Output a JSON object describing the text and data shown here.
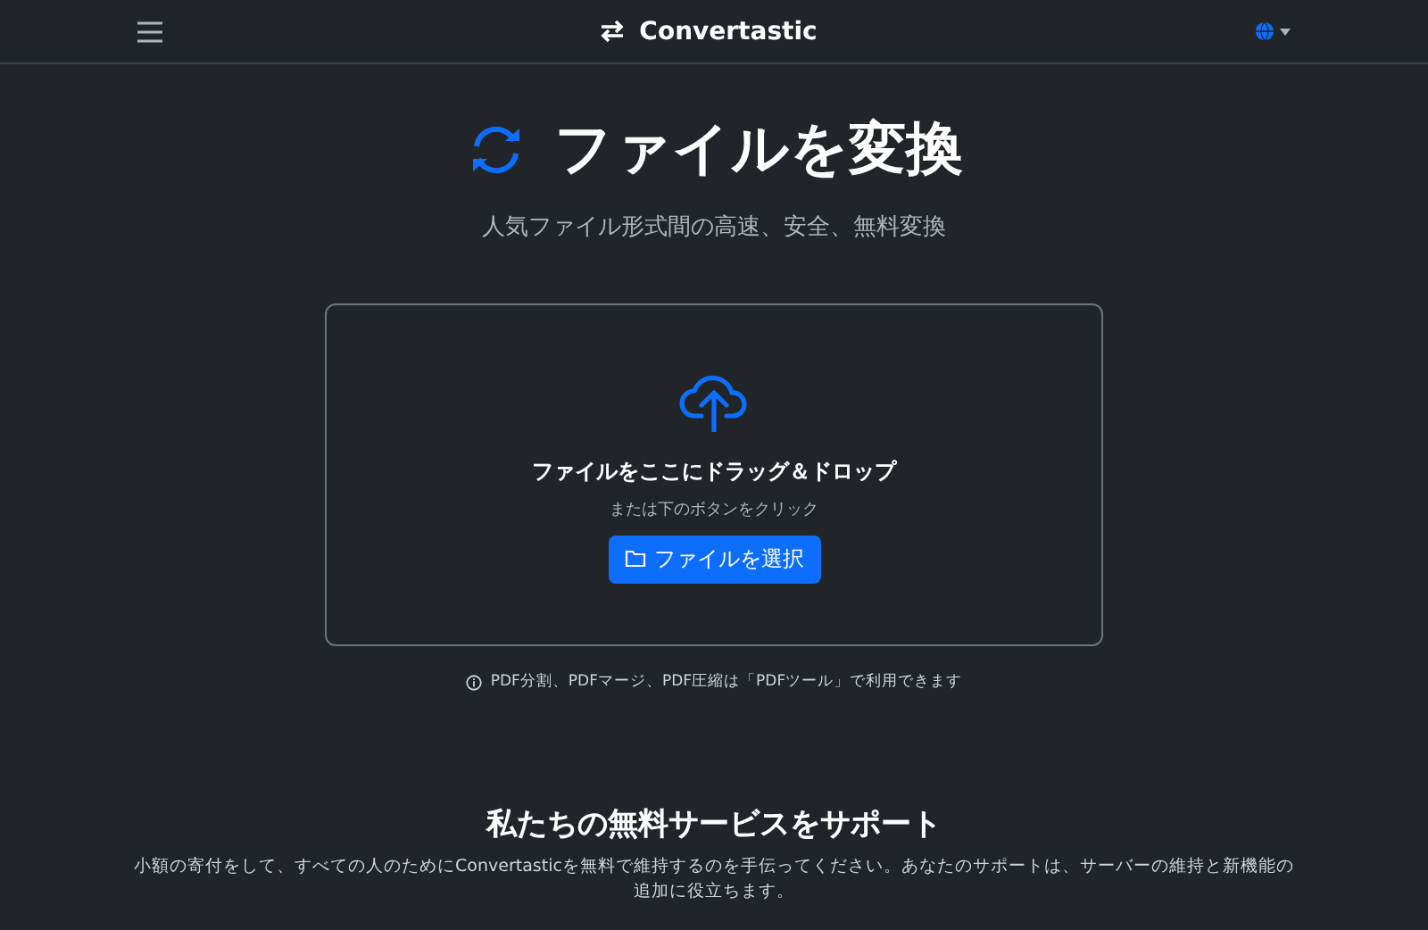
{
  "navbar": {
    "brand": "Convertastic"
  },
  "hero": {
    "title": "ファイルを変換",
    "subtitle": "人気ファイル形式間の高速、安全、無料変換"
  },
  "dropzone": {
    "heading": "ファイルをここにドラッグ＆ドロップ",
    "hint": "または下のボタンをクリック",
    "button": "ファイルを選択"
  },
  "note": "PDF分割、PDFマージ、PDF圧縮は「PDFツール」で利用できます",
  "support": {
    "heading": "私たちの無料サービスをサポート",
    "text": "小額の寄付をして、すべての人のためにConvertasticを無料で維持するのを手伝ってください。あなたのサポートは、サーバーの維持と新機能の追加に役立ちます。"
  }
}
